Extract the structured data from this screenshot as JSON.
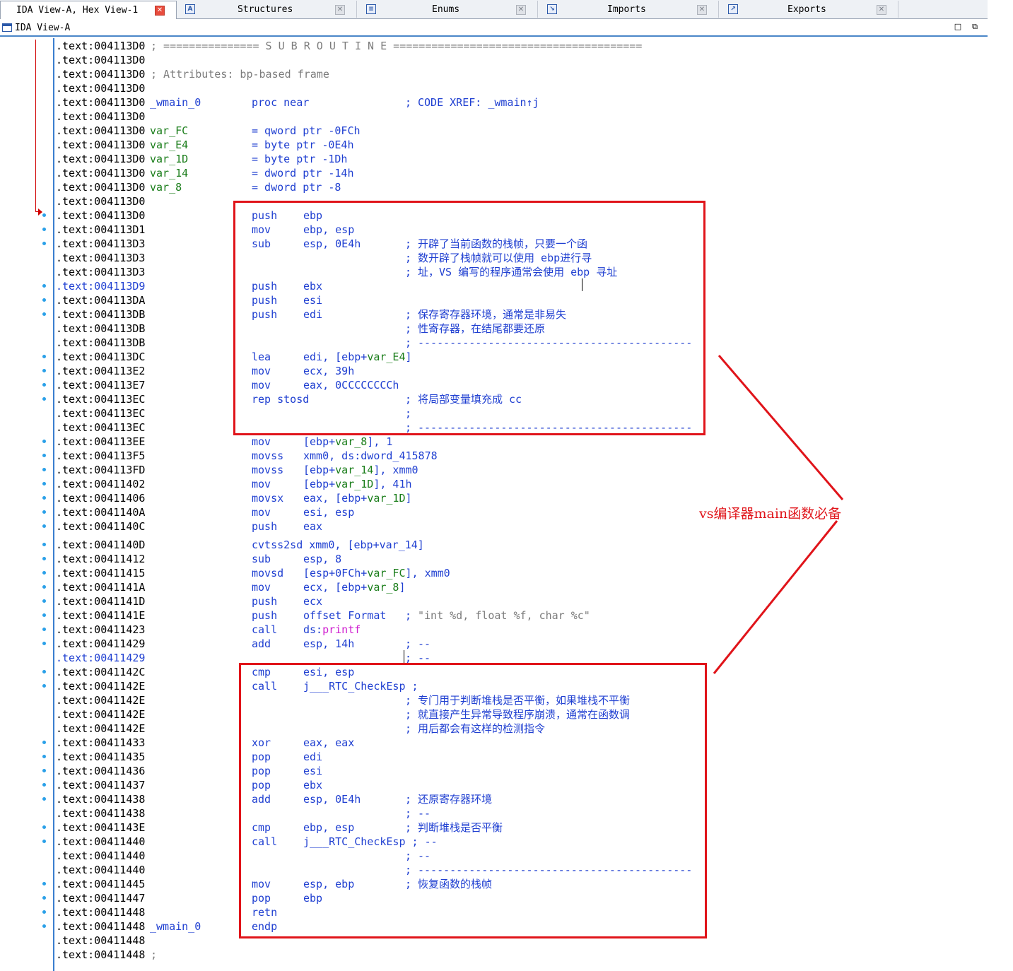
{
  "tabs": [
    {
      "label": "IDA View-A, Hex View-1",
      "active": true
    },
    {
      "label": "Structures",
      "icon": "structures-icon"
    },
    {
      "label": "Enums",
      "icon": "enums-icon"
    },
    {
      "label": "Imports",
      "icon": "imports-icon"
    },
    {
      "label": "Exports",
      "icon": "exports-icon"
    }
  ],
  "view_title": "IDA View-A",
  "annotation": "vs编译器main函数必备",
  "colors": {
    "red_annotation": "#e0141a",
    "code_blue": "#1f3fd1",
    "name_green": "#1a7d1a",
    "comment_gray": "#7c7c7c"
  },
  "listing": [
    {
      "addr": ".text:004113D0",
      "cmt": "; =============== S U B R O U T I N E ======================================="
    },
    {
      "addr": ".text:004113D0"
    },
    {
      "addr": ".text:004113D0",
      "cmt": "; Attributes: bp-based frame"
    },
    {
      "addr": ".text:004113D0"
    },
    {
      "addr": ".text:004113D0",
      "name": "_wmain_0",
      "mn": "proc near",
      "c1": ";",
      "c2": "CODE XREF: _wmain↑j"
    },
    {
      "addr": ".text:004113D0"
    },
    {
      "addr": ".text:004113D0",
      "name": "var_FC",
      "mn": "= qword ptr -0FCh"
    },
    {
      "addr": ".text:004113D0",
      "name": "var_E4",
      "mn": "= byte ptr -0E4h"
    },
    {
      "addr": ".text:004113D0",
      "name": "var_1D",
      "mn": "= byte ptr -1Dh"
    },
    {
      "addr": ".text:004113D0",
      "name": "var_14",
      "mn": "= dword ptr -14h"
    },
    {
      "addr": ".text:004113D0",
      "name": "var_8",
      "mn": "= dword ptr -8"
    },
    {
      "addr": ".text:004113D0"
    },
    {
      "addr": ".text:004113D0",
      "mn": "push",
      "op": "ebp"
    },
    {
      "addr": ".text:004113D1",
      "mn": "mov",
      "op": "ebp, esp"
    },
    {
      "addr": ".text:004113D3",
      "mn": "sub",
      "op": "esp, 0E4h",
      "c1": ";",
      "c2": "开辟了当前函数的栈帧，只要一个函"
    },
    {
      "addr": ".text:004113D3",
      "c1": ";",
      "c2": "数开辟了栈帧就可以使用 ebp进行寻"
    },
    {
      "addr": ".text:004113D3",
      "c1": ";",
      "c2": "址，VS 编写的程序通常会使用 ebp 寻址"
    },
    {
      "addr": ".text:004113D9",
      "mn": "push",
      "op": "ebx"
    },
    {
      "addr": ".text:004113DA",
      "mn": "push",
      "op": "esi"
    },
    {
      "addr": ".text:004113DB",
      "mn": "push",
      "op": "edi",
      "c1": ";",
      "c2": "保存寄存器环境，通常是非易失"
    },
    {
      "addr": ".text:004113DB",
      "c1": ";",
      "c2": "性寄存器，在结尾都要还原"
    },
    {
      "addr": ".text:004113DB",
      "c1": ";",
      "c2": "-------------------------------------------"
    },
    {
      "addr": ".text:004113DC",
      "mn": "lea",
      "op": "edi, [ebp+var_E4]"
    },
    {
      "addr": ".text:004113E2",
      "mn": "mov",
      "op": "ecx, 39h"
    },
    {
      "addr": ".text:004113E7",
      "mn": "mov",
      "op": "eax, 0CCCCCCCCh"
    },
    {
      "addr": ".text:004113EC",
      "mn": "rep stosd",
      "c1": ";",
      "c2": "将局部变量填充成 cc"
    },
    {
      "addr": ".text:004113EC",
      "c1": ";"
    },
    {
      "addr": ".text:004113EC",
      "c1": ";",
      "c2": "-------------------------------------------"
    },
    {
      "addr": ".text:004113EE",
      "mn": "mov",
      "op": "[ebp+var_8], 1"
    },
    {
      "addr": ".text:004113F5",
      "mn": "movss",
      "op": "xmm0, ds:dword_415878"
    },
    {
      "addr": ".text:004113FD",
      "mn": "movss",
      "op": "[ebp+var_14], xmm0"
    },
    {
      "addr": ".text:00411402",
      "mn": "mov",
      "op": "[ebp+var_1D], 41h"
    },
    {
      "addr": ".text:00411406",
      "mn": "movsx",
      "op": "eax, [ebp+var_1D]"
    },
    {
      "addr": ".text:0041140A",
      "mn": "mov",
      "op": "esi, esp"
    },
    {
      "addr": ".text:0041140C",
      "mn": "push",
      "op": "eax"
    },
    {
      "addr": ".text:0041140D",
      "mn": "cvtss2sd xmm0, [ebp+var_14]"
    },
    {
      "addr": ".text:00411412",
      "mn": "sub",
      "op": "esp, 8"
    },
    {
      "addr": ".text:00411415",
      "mn": "movsd",
      "op": "[esp+0FCh+var_FC], xmm0"
    },
    {
      "addr": ".text:0041141A",
      "mn": "mov",
      "op": "ecx, [ebp+var_8]"
    },
    {
      "addr": ".text:0041141D",
      "mn": "push",
      "op": "ecx"
    },
    {
      "addr": ".text:0041141E",
      "mn": "push",
      "op": "offset Format",
      "c1": ";",
      "c2": "\"int %d, float %f, char %c\""
    },
    {
      "addr": ".text:00411423",
      "mn": "call",
      "op": "ds:printf"
    },
    {
      "addr": ".text:00411429",
      "mn": "add",
      "op": "esp, 14h",
      "c1": ";",
      "c2": "--"
    },
    {
      "addr": ".text:00411429",
      "c1": ";",
      "c2": "--"
    },
    {
      "addr": ".text:0041142C",
      "mn": "cmp",
      "op": "esi, esp"
    },
    {
      "addr": ".text:0041142E",
      "mn": "call",
      "op": "j___RTC_CheckEsp ;"
    },
    {
      "addr": ".text:0041142E",
      "c1": ";",
      "c2": "专门用于判断堆栈是否平衡，如果堆栈不平衡"
    },
    {
      "addr": ".text:0041142E",
      "c1": ";",
      "c2": "就直接产生异常导致程序崩溃，通常在函数调"
    },
    {
      "addr": ".text:0041142E",
      "c1": ";",
      "c2": "用后都会有这样的检测指令"
    },
    {
      "addr": ".text:00411433",
      "mn": "xor",
      "op": "eax, eax"
    },
    {
      "addr": ".text:00411435",
      "mn": "pop",
      "op": "edi"
    },
    {
      "addr": ".text:00411436",
      "mn": "pop",
      "op": "esi"
    },
    {
      "addr": ".text:00411437",
      "mn": "pop",
      "op": "ebx"
    },
    {
      "addr": ".text:00411438",
      "mn": "add",
      "op": "esp, 0E4h",
      "c1": ";",
      "c2": "还原寄存器环境"
    },
    {
      "addr": ".text:00411438",
      "c1": ";",
      "c2": "--"
    },
    {
      "addr": ".text:0041143E",
      "mn": "cmp",
      "op": "ebp, esp",
      "c1": ";",
      "c2": "判断堆栈是否平衡"
    },
    {
      "addr": ".text:00411440",
      "mn": "call",
      "op": "j___RTC_CheckEsp ; --"
    },
    {
      "addr": ".text:00411440",
      "c1": ";",
      "c2": "--"
    },
    {
      "addr": ".text:00411440",
      "c1": ";",
      "c2": "-------------------------------------------"
    },
    {
      "addr": ".text:00411445",
      "mn": "mov",
      "op": "esp, ebp",
      "c1": ";",
      "c2": "恢复函数的栈帧"
    },
    {
      "addr": ".text:00411447",
      "mn": "pop",
      "op": "ebp"
    },
    {
      "addr": ".text:00411448",
      "mn": "retn"
    },
    {
      "addr": ".text:00411448",
      "name": "_wmain_0",
      "mn": "endp"
    },
    {
      "addr": ".text:00411448"
    },
    {
      "addr": ".text:00411448",
      "cmt": ";"
    }
  ]
}
